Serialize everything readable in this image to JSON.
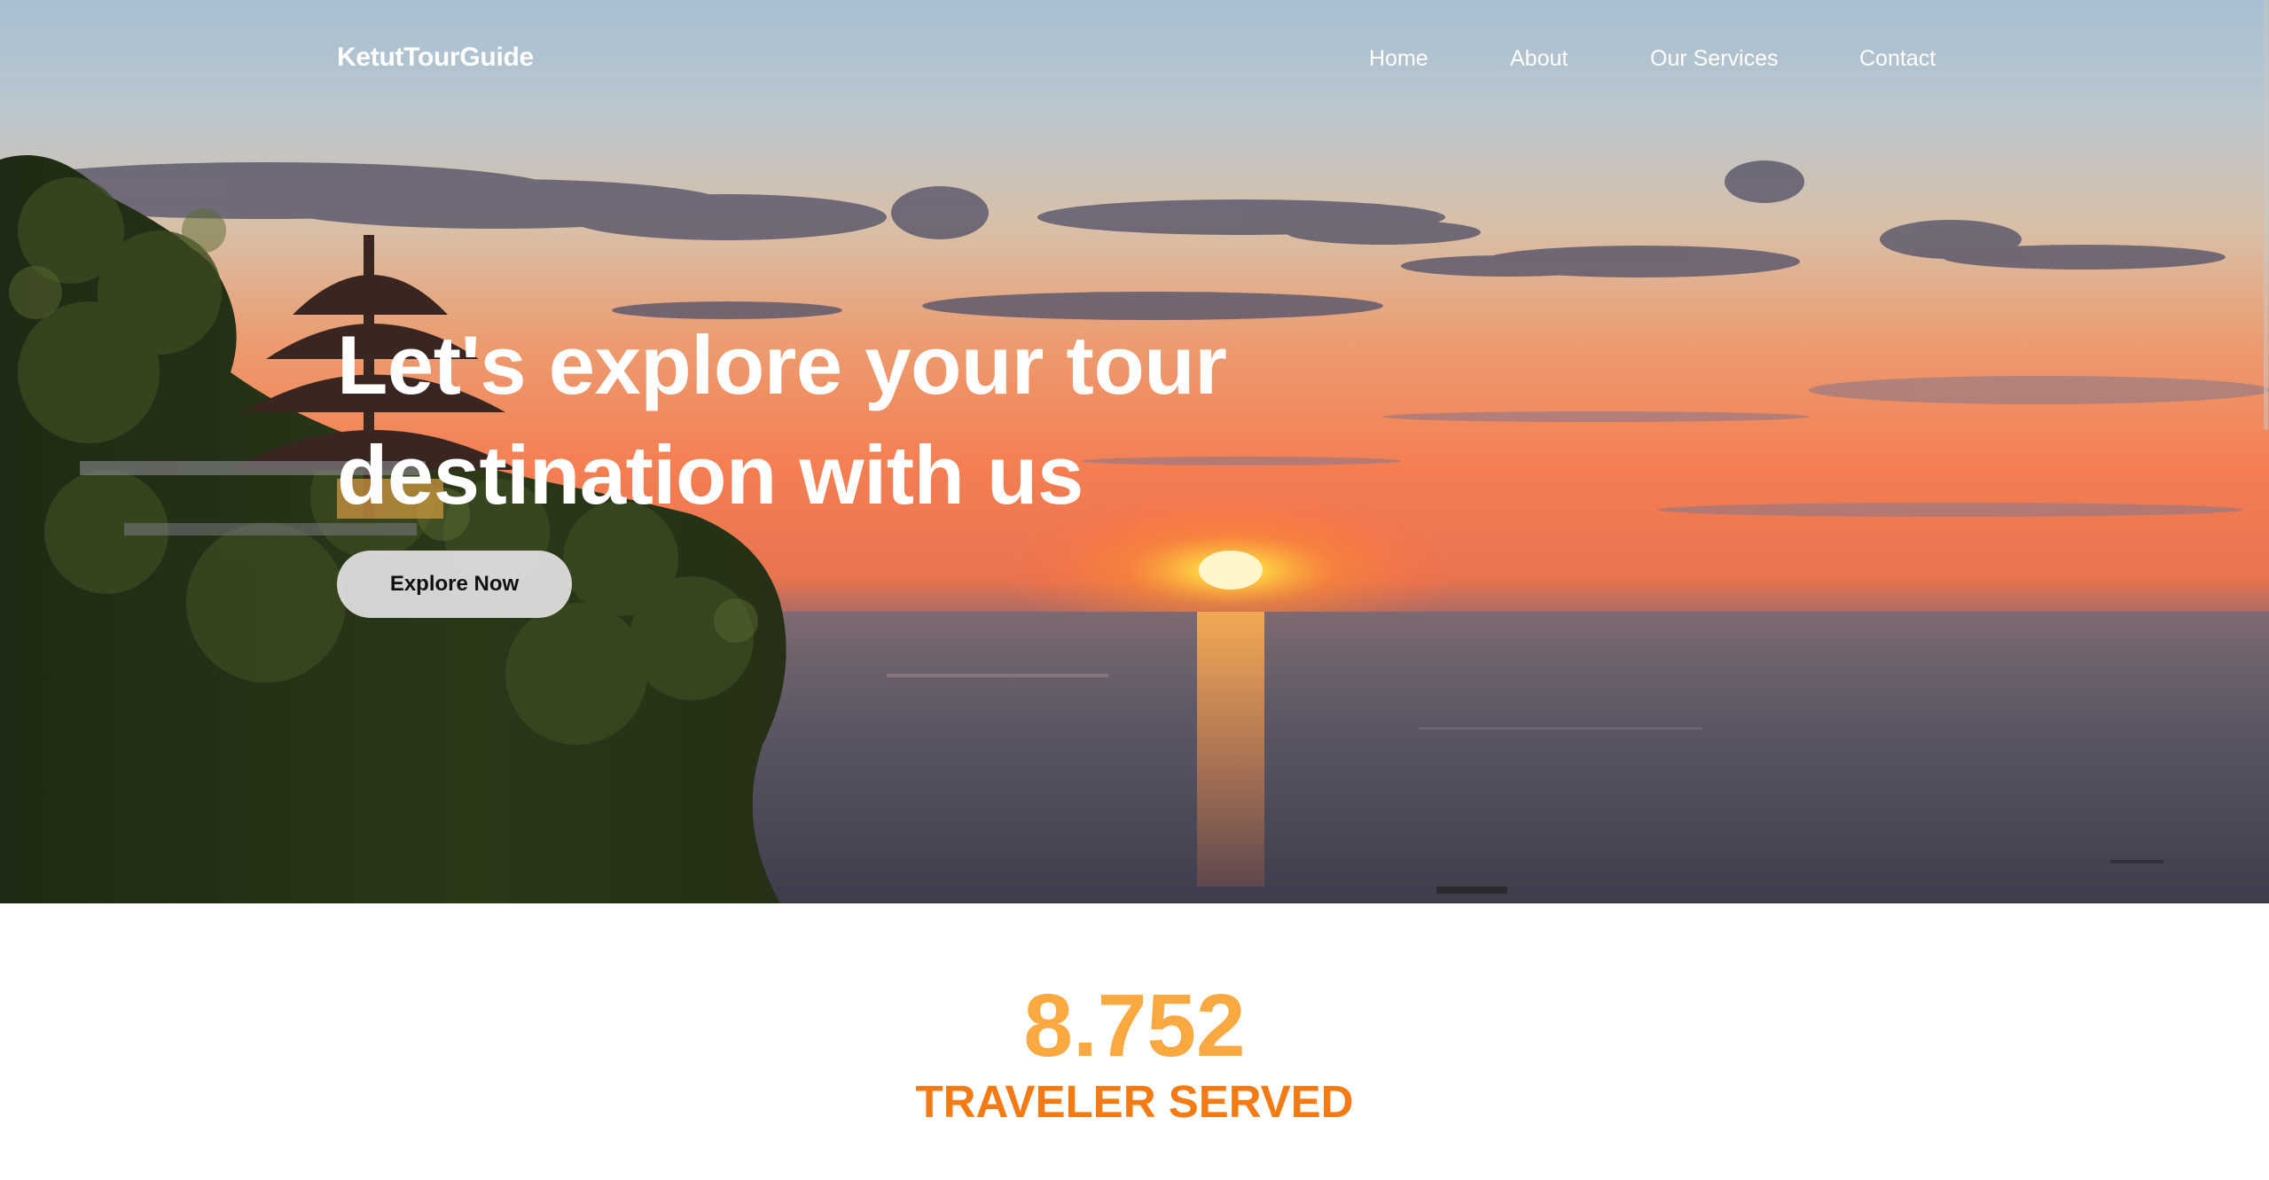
{
  "nav": {
    "brand": "KetutTourGuide",
    "links": [
      "Home",
      "About",
      "Our Services",
      "Contact"
    ]
  },
  "hero": {
    "headline": "Let's explore your tour destination with us",
    "cta_label": "Explore Now",
    "background": "sunset-over-ocean-with-temple-cliff-image"
  },
  "stats": {
    "number": "8.752",
    "label": "TRAVELER SERVED"
  },
  "colors": {
    "stat_number": "#f9a940",
    "stat_label": "#f47a14",
    "nav_text": "#ffffff",
    "cta_background": "#e1e1e1"
  },
  "icons": {
    "scrollbar": "scrollbar-thumb"
  }
}
